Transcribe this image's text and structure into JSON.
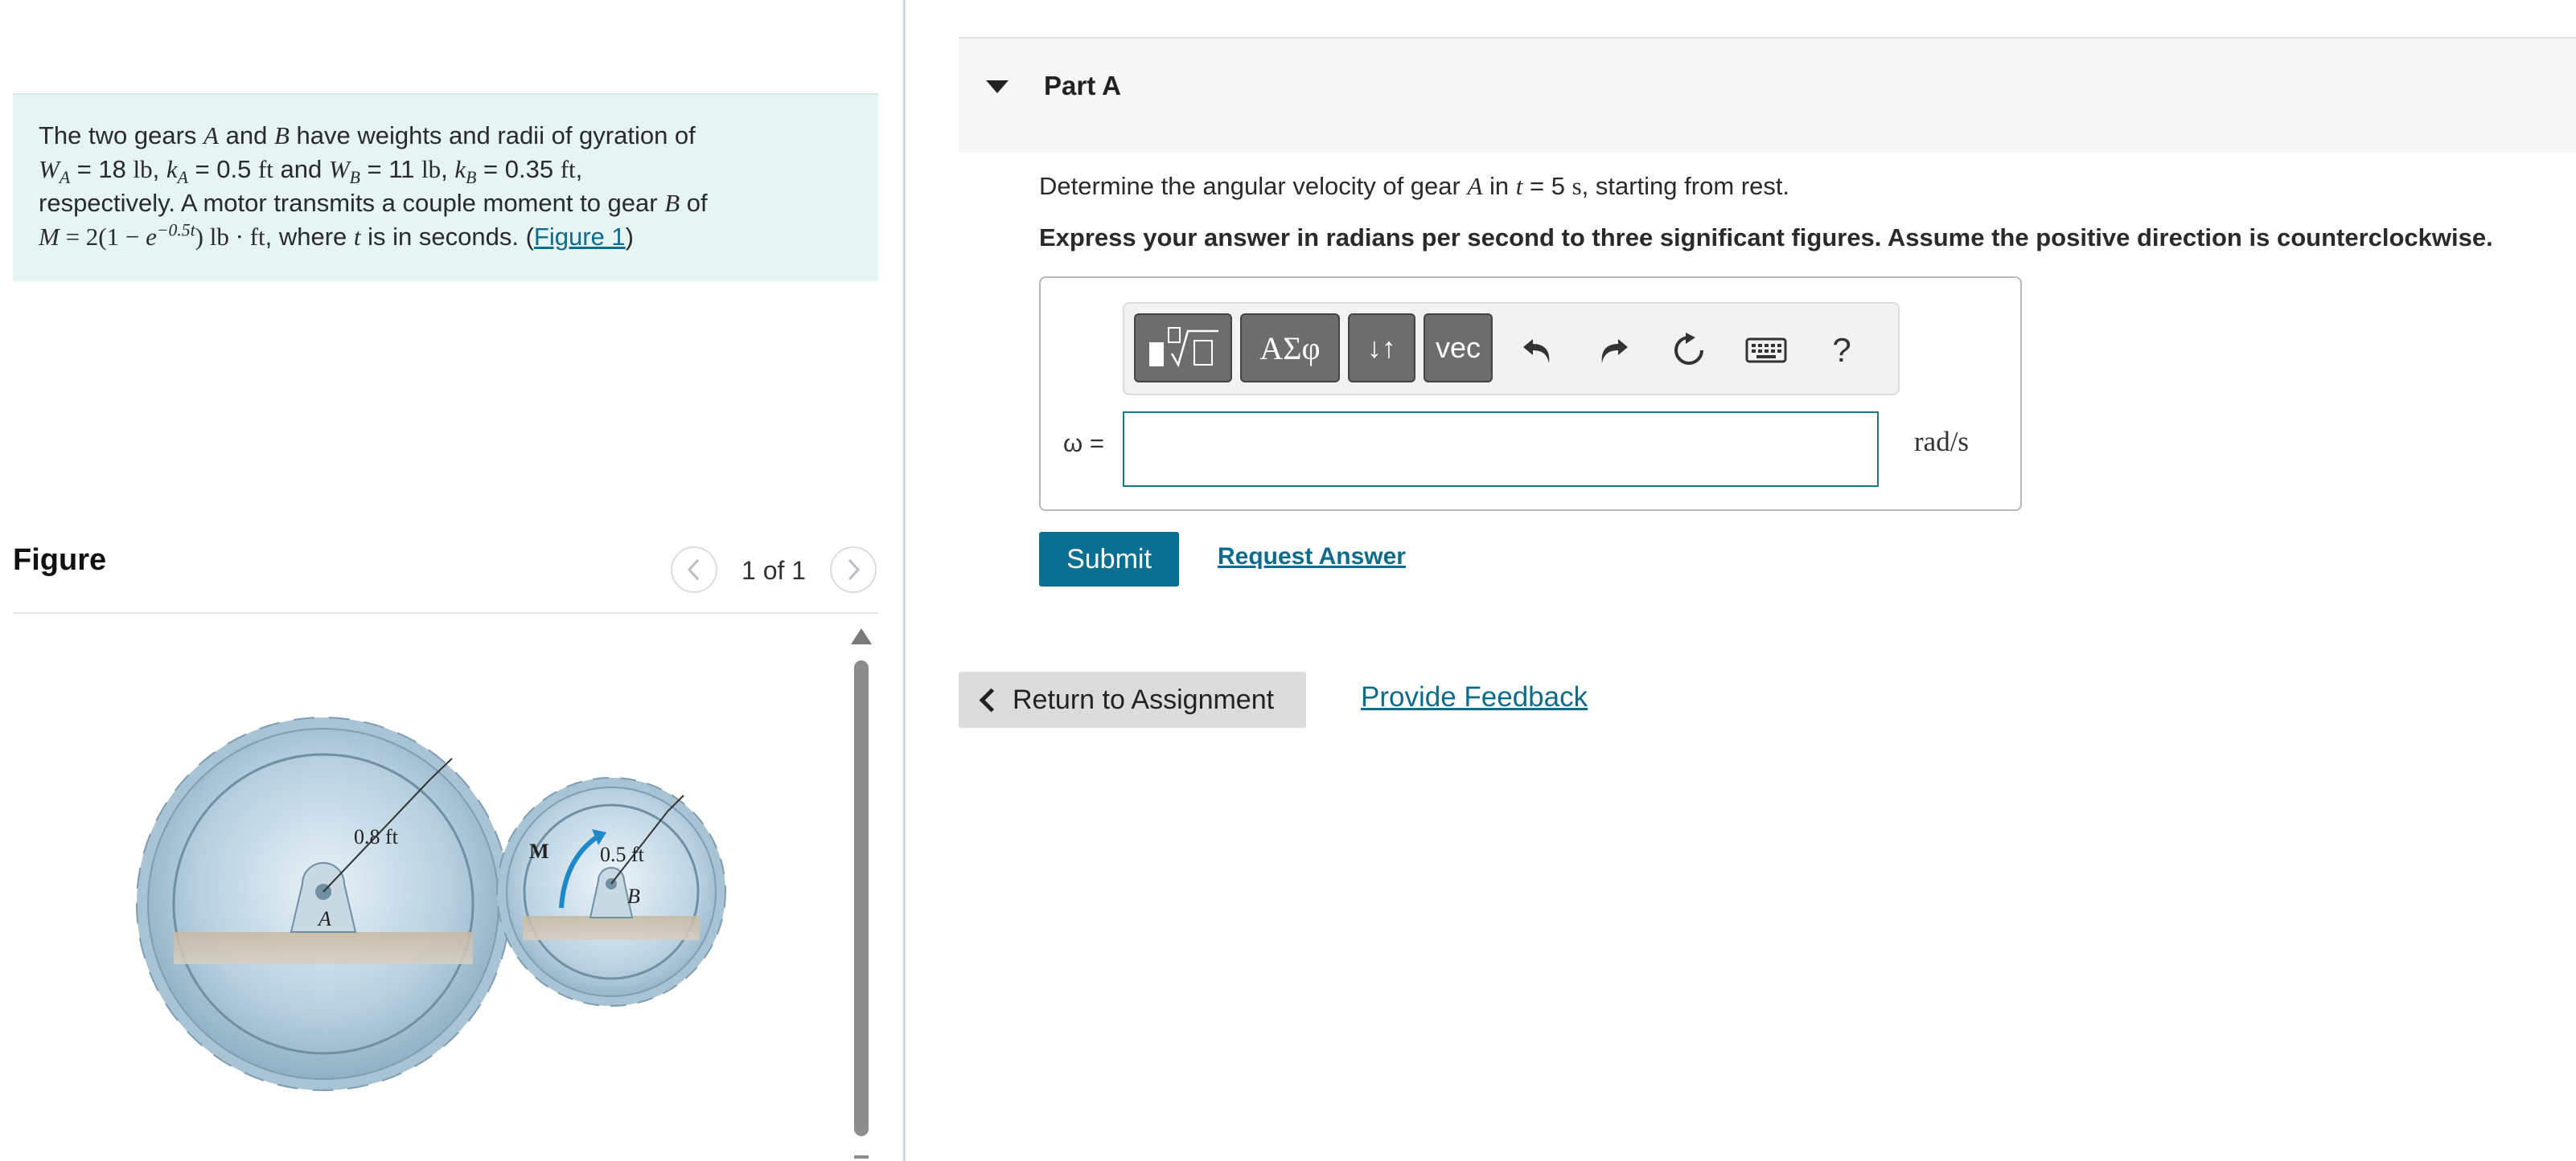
{
  "problem": {
    "text": {
      "l1a": "The two gears ",
      "gearA": "A",
      "and": " and ",
      "gearB": "B",
      "l1b": " have weights and radii of gyration of",
      "WA": "W",
      "WAsub": "A",
      "WAval": " = 18 ",
      "lb1": "lb",
      "comma1": ", ",
      "kA": "k",
      "kAsub": "A",
      "kAval": " = 0.5 ",
      "ft1": "ft",
      "and2": " and  ",
      "WB": "W",
      "WBsub": "B",
      "WBval": " = 11 ",
      "lb2": "lb",
      "comma2": ", ",
      "kB": "k",
      "kBsub": "B",
      "kBval": " = 0.35 ",
      "ft2": "ft",
      "comma3": ",",
      "l3a": "respectively. A motor transmits a couple moment to gear ",
      "gearB2": "B",
      "l3b": " of",
      "M": "M",
      "Meq": " = 2(1 − ",
      "e": "e",
      "exp": "−0.5t",
      "Mclose": ") ",
      "lbft": "lb · ft",
      "l4a": ", where ",
      "t": "t",
      "l4b": " is in seconds. (",
      "figure_link": "Figure 1",
      "l4c": ")"
    }
  },
  "figure": {
    "title": "Figure",
    "counter": "1 of 1",
    "label_radius_a": "0.8 ft",
    "label_radius_b": "0.5 ft",
    "label_moment": "M",
    "label_a": "A",
    "label_b": "B"
  },
  "part": {
    "title": "Part A",
    "question": {
      "pre": "Determine the angular velocity of gear ",
      "gear": "A",
      "mid": " in ",
      "t": "t",
      "eq": " = 5 ",
      "unit": "s",
      "post": ", starting from rest."
    },
    "instruction": "Express your answer in radians per second to three significant figures. Assume the positive direction is counterclockwise."
  },
  "toolbar": {
    "symbols_label": "ΑΣφ",
    "updown_label": "↓↑",
    "vec_label": "vec",
    "help_label": "?"
  },
  "answer": {
    "variable_label": "ω =",
    "value": "",
    "unit": "rad/s"
  },
  "actions": {
    "submit": "Submit",
    "request_answer": "Request Answer",
    "return": "Return to Assignment",
    "feedback": "Provide Feedback"
  },
  "colors": {
    "accent": "#0a6f91",
    "link": "#0d6b8c",
    "problem_bg": "#e6f4f4"
  }
}
